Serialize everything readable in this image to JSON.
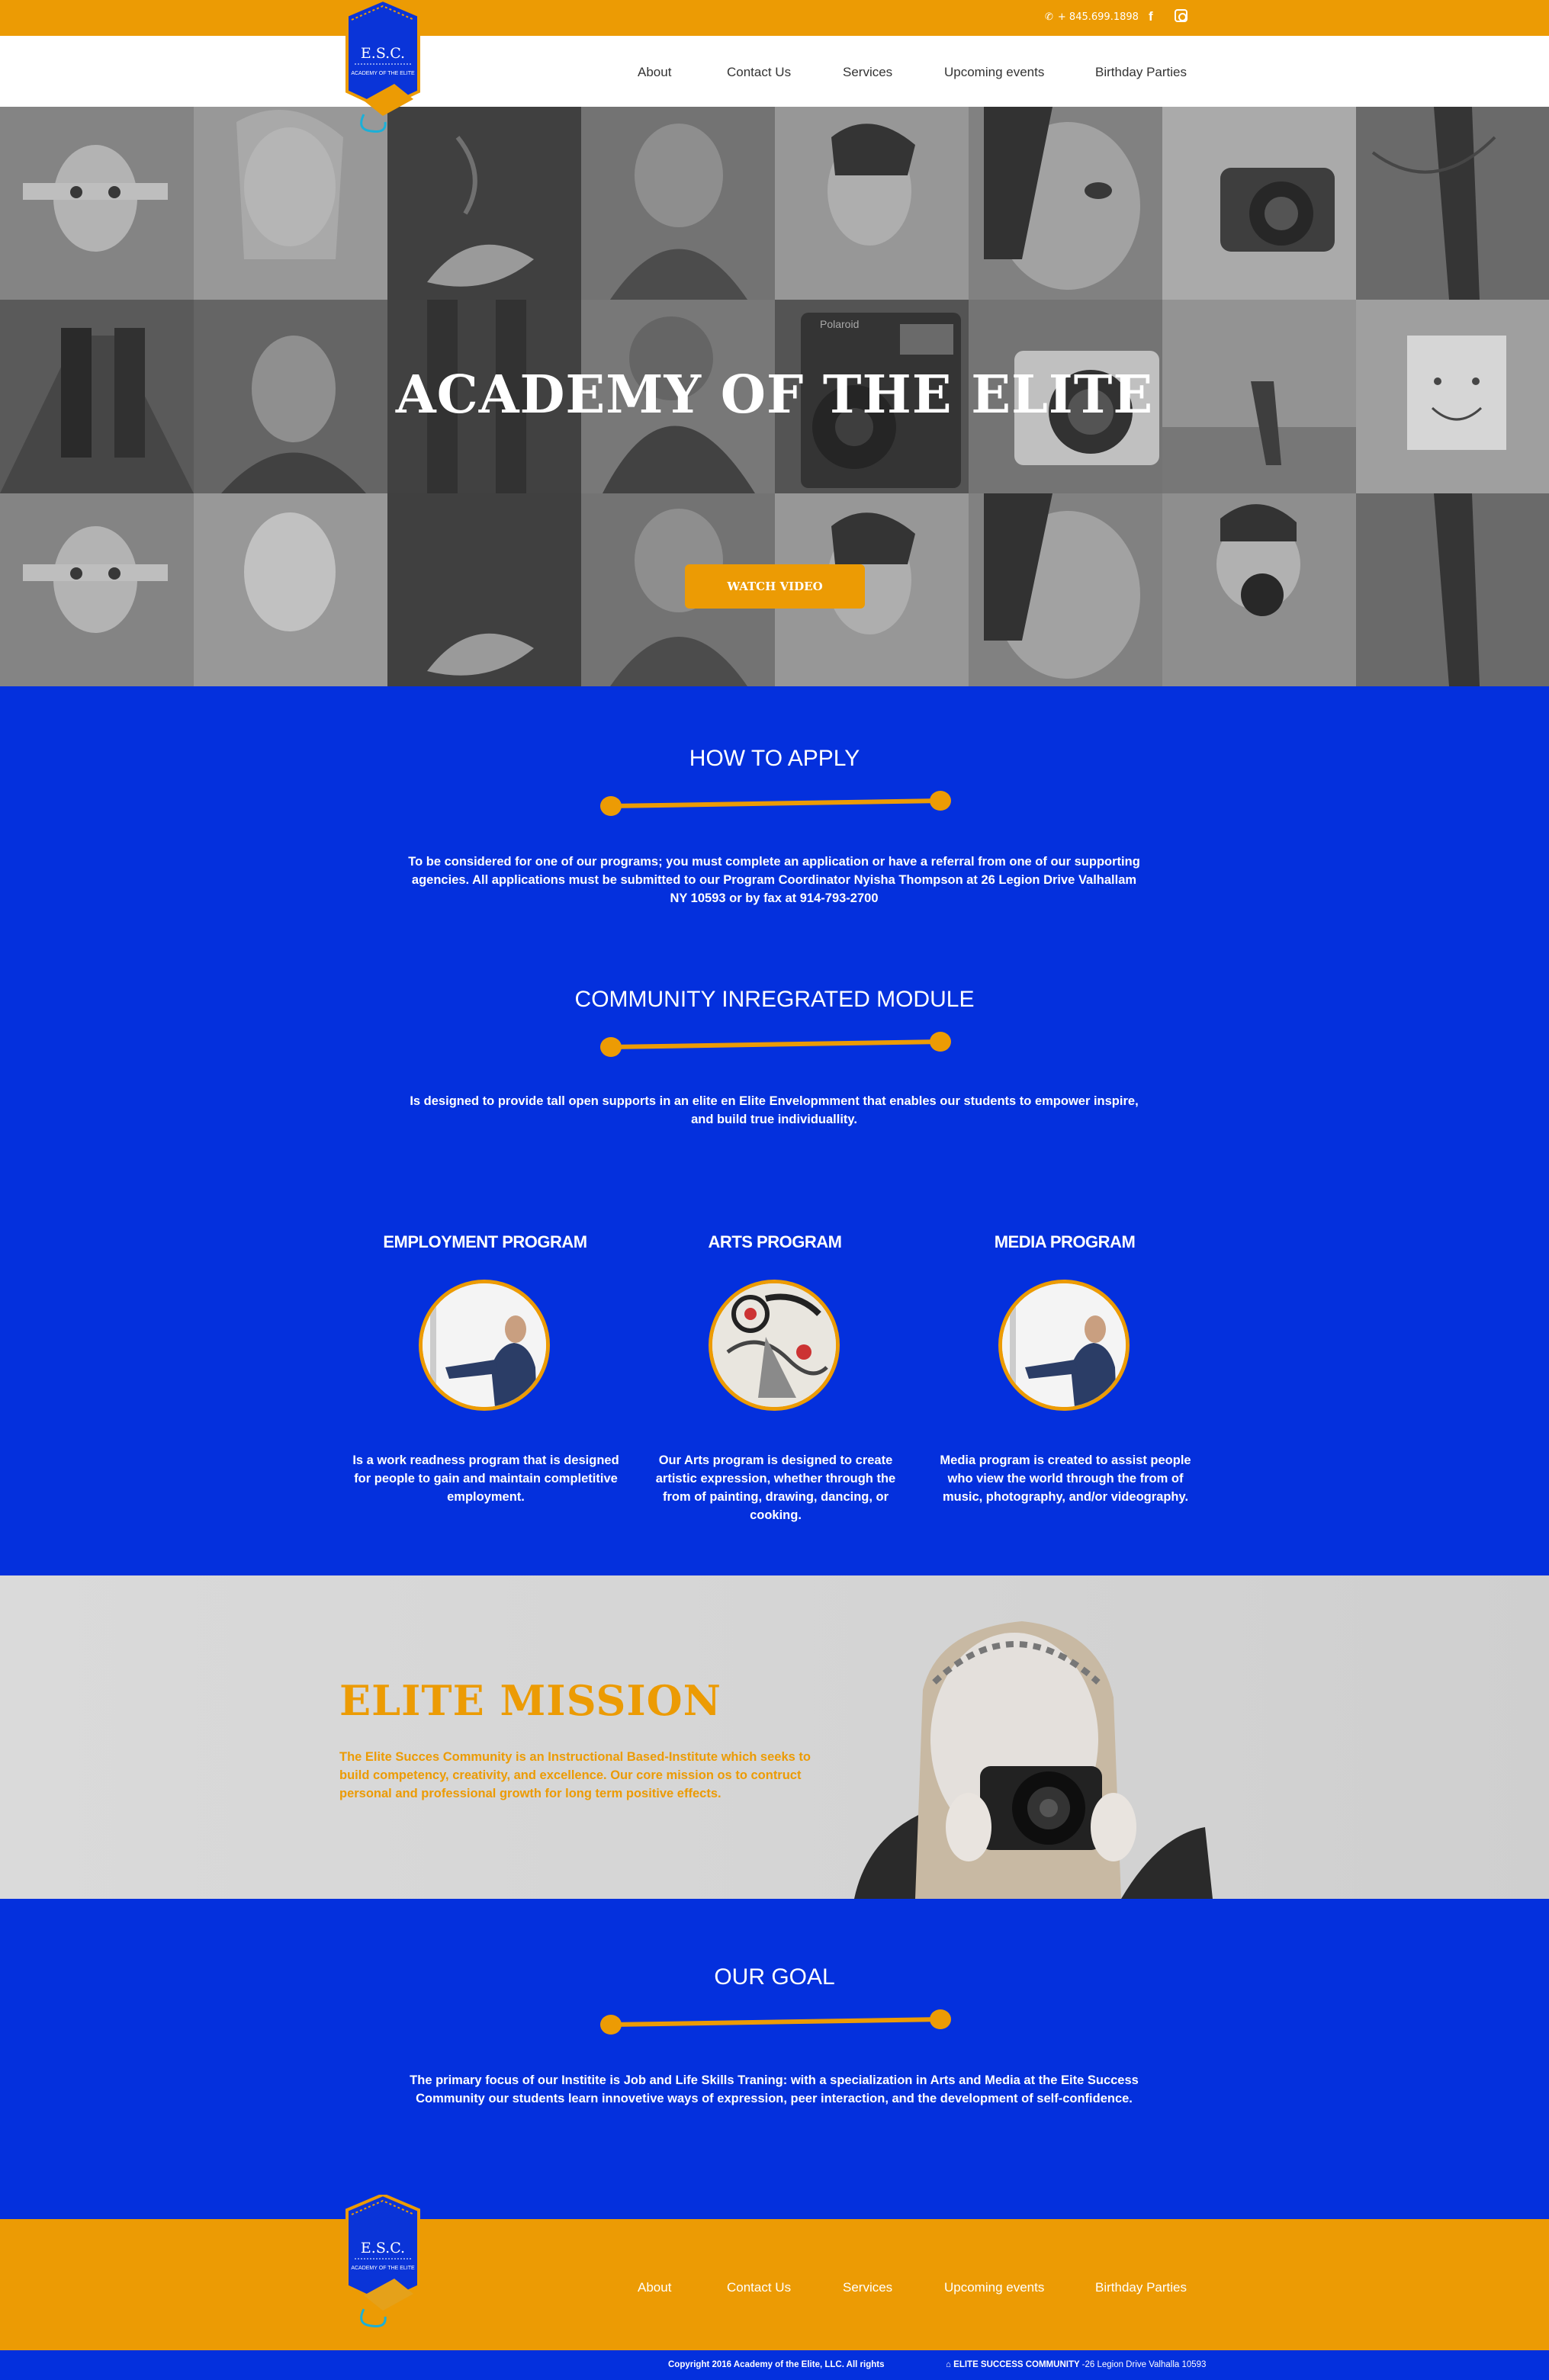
{
  "topbar": {
    "phone": "+ 845.699.1898",
    "facebook": "f"
  },
  "logo": {
    "initials": "E.S.C.",
    "subtitle": "ACADEMY OF THE ELITE"
  },
  "nav": {
    "items": [
      "About",
      "Contact Us",
      "Services",
      "Upcoming events",
      "Birthday Parties"
    ]
  },
  "hero": {
    "title": "ACADEMY OF THE ELITE",
    "button": "WATCH VIDEO",
    "polaroid_label": "Polaroid"
  },
  "apply": {
    "title": "HOW TO APPLY",
    "text": "To be considered for one of our programs; you must complete an application or have a referral from one of our supporting agencies. All applications must be submitted to our Program Coordinator Nyisha Thompson at 26 Legion Drive Valhallam NY 10593 or by fax at 914-793-2700"
  },
  "module": {
    "title": "COMMUNITY INREGRATED MODULE",
    "text": "Is designed to provide tall open supports in an elite en Elite Envelopmment that enables our students to  empower inspire, and build true individuallity."
  },
  "programs": [
    {
      "title": "EMPLOYMENT PROGRAM",
      "text": "Is a work readness program that is designed for people to gain and maintain completitive employment."
    },
    {
      "title": "ARTS PROGRAM",
      "text": "Our Arts program is designed to create artistic expression, whether through the from of painting, drawing, dancing, or cooking."
    },
    {
      "title": "MEDIA PROGRAM",
      "text": "Media program is created to assist people who view the world through the from of music, photography, and/or videography."
    }
  ],
  "mission": {
    "title": "ELITE MISSION",
    "text": "The Elite Succes Community is an Instructional Based-Institute which seeks to build competency, creativity, and excellence. Our core mission os to contruct personal and professional growth for long term positive effects."
  },
  "goal": {
    "title": "OUR GOAL",
    "text": "The primary focus of our Institite is Job and Life Skills Traning: with a specialization in Arts and Media at the Eite Success Community our students learn innovetive ways of expression, peer interaction, and the development of self-confidence."
  },
  "footer": {
    "nav": [
      "About",
      "Contact Us",
      "Services",
      "Upcoming events",
      "Birthday Parties"
    ],
    "copyright": "Copyright 2016 Academy of the Elite, LLC. All rights",
    "address_name": "ELITE SUCCESS COMMUNITY",
    "address": "-26 Legion Drive Valhalla 10593"
  },
  "colors": {
    "orange": "#ec9b04",
    "blue": "#0430dd",
    "white": "#ffffff"
  }
}
